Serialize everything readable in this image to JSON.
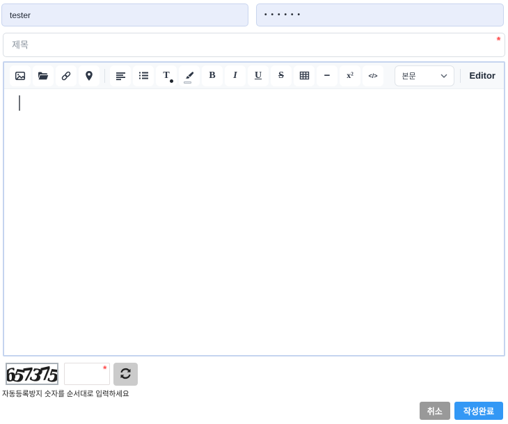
{
  "colors": {
    "autofill_bg": "#e9eefb",
    "autofill_border": "#c9d5ee",
    "editor_border": "#c5d4ef",
    "toolbar_bg": "#f7f9fb",
    "icon_color": "#2f3847",
    "required_red": "#ff4d4d",
    "cancel_gray": "#999999",
    "submit_blue": "#3398f5"
  },
  "fields": {
    "username": {
      "value": "tester"
    },
    "password": {
      "value": "••••••"
    },
    "title": {
      "placeholder": "제목",
      "required_mark": "*"
    }
  },
  "editor": {
    "toolbar": {
      "icons": [
        "image",
        "folder-open",
        "link",
        "map-marker",
        "align-left",
        "list-ul",
        "font-color",
        "highlight",
        "bold",
        "italic",
        "underline",
        "strikethrough",
        "table",
        "horizontal-rule",
        "superscript",
        "code-view"
      ],
      "glyphs": {
        "font_color": "T",
        "bold": "B",
        "italic": "I",
        "underline": "U",
        "strikethrough": "S",
        "horizontal_rule": "−",
        "superscript": "x²",
        "code_view": "</>"
      },
      "format_select": {
        "value": "본문"
      },
      "editor_label": "Editor"
    },
    "content": {
      "value": ""
    }
  },
  "captcha": {
    "digits": "657375",
    "digits_list": [
      "6",
      "5",
      "7",
      "3",
      "7",
      "5"
    ],
    "input": {
      "value": "",
      "required_mark": "*"
    },
    "help_text": "자동등록방지 숫자를 순서대로 입력하세요"
  },
  "actions": {
    "cancel_label": "취소",
    "submit_label": "작성완료"
  }
}
